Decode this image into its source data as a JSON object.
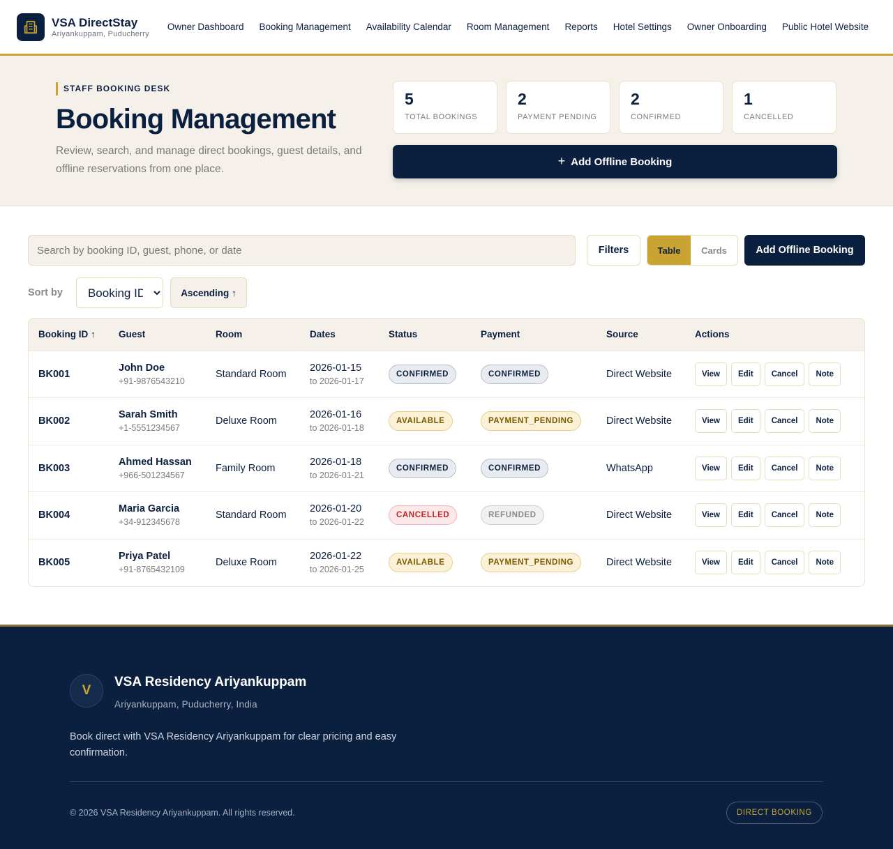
{
  "brand": {
    "name": "VSA DirectStay",
    "location": "Ariyankuppam, Puducherry"
  },
  "nav": [
    "Owner Dashboard",
    "Booking Management",
    "Availability Calendar",
    "Room Management",
    "Reports",
    "Hotel Settings",
    "Owner Onboarding",
    "Public Hotel Website"
  ],
  "hero": {
    "eyebrow": "STAFF BOOKING DESK",
    "title": "Booking Management",
    "description": "Review, search, and manage direct bookings, guest details, and offline reservations from one place.",
    "add_button": "Add Offline Booking",
    "stats": [
      {
        "value": "5",
        "label": "TOTAL BOOKINGS"
      },
      {
        "value": "2",
        "label": "PAYMENT PENDING"
      },
      {
        "value": "2",
        "label": "CONFIRMED"
      },
      {
        "value": "1",
        "label": "CANCELLED"
      }
    ]
  },
  "toolbar": {
    "search_placeholder": "Search by booking ID, guest, phone, or date",
    "filters_label": "Filters",
    "view_table": "Table",
    "view_cards": "Cards",
    "add_label": "Add Offline Booking",
    "sort_label": "Sort by",
    "sort_value": "Booking ID",
    "order_label": "Ascending ↑"
  },
  "table": {
    "headers": [
      "Booking ID ↑",
      "Guest",
      "Room",
      "Dates",
      "Status",
      "Payment",
      "Source",
      "Actions"
    ],
    "action_labels": [
      "View",
      "Edit",
      "Cancel",
      "Note"
    ],
    "rows": [
      {
        "id": "BK001",
        "guest": "John Doe",
        "phone": "+91-9876543210",
        "room": "Standard Room",
        "start": "2026-01-15",
        "end": "to 2026-01-17",
        "status": "CONFIRMED",
        "status_kind": "confirmed",
        "payment": "CONFIRMED",
        "payment_kind": "confirmed",
        "source": "Direct Website"
      },
      {
        "id": "BK002",
        "guest": "Sarah Smith",
        "phone": "+1-5551234567",
        "room": "Deluxe Room",
        "start": "2026-01-16",
        "end": "to 2026-01-18",
        "status": "AVAILABLE",
        "status_kind": "available",
        "payment": "PAYMENT_PENDING",
        "payment_kind": "pending",
        "source": "Direct Website"
      },
      {
        "id": "BK003",
        "guest": "Ahmed Hassan",
        "phone": "+966-501234567",
        "room": "Family Room",
        "start": "2026-01-18",
        "end": "to 2026-01-21",
        "status": "CONFIRMED",
        "status_kind": "confirmed",
        "payment": "CONFIRMED",
        "payment_kind": "confirmed",
        "source": "WhatsApp"
      },
      {
        "id": "BK004",
        "guest": "Maria Garcia",
        "phone": "+34-912345678",
        "room": "Standard Room",
        "start": "2026-01-20",
        "end": "to 2026-01-22",
        "status": "CANCELLED",
        "status_kind": "cancelled",
        "payment": "REFUNDED",
        "payment_kind": "refunded",
        "source": "Direct Website"
      },
      {
        "id": "BK005",
        "guest": "Priya Patel",
        "phone": "+91-8765432109",
        "room": "Deluxe Room",
        "start": "2026-01-22",
        "end": "to 2026-01-25",
        "status": "AVAILABLE",
        "status_kind": "available",
        "payment": "PAYMENT_PENDING",
        "payment_kind": "pending",
        "source": "Direct Website"
      }
    ]
  },
  "footer": {
    "avatar": "V",
    "name": "VSA Residency Ariyankuppam",
    "location": "Ariyankuppam, Puducherry, India",
    "description": "Book direct with VSA Residency Ariyankuppam for clear pricing and easy confirmation.",
    "copyright": "© 2026 VSA Residency Ariyankuppam. All rights reserved.",
    "badge": "DIRECT BOOKING"
  },
  "colors": {
    "navy": "#0b1f3f",
    "gold": "#c9a432",
    "cream": "#f5f1ea"
  },
  "icons": {
    "brand": "hotel-building-icon",
    "add": "plus-icon"
  }
}
